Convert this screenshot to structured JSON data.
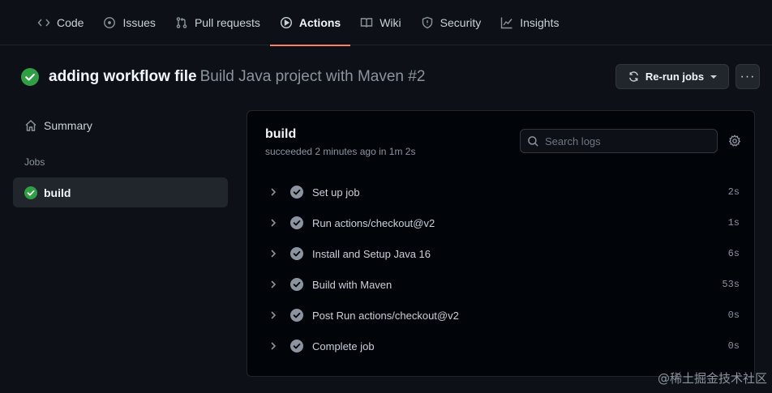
{
  "nav": {
    "tabs": [
      {
        "label": "Code",
        "icon": "code-icon"
      },
      {
        "label": "Issues",
        "icon": "issue-icon"
      },
      {
        "label": "Pull requests",
        "icon": "pull-request-icon"
      },
      {
        "label": "Actions",
        "icon": "play-icon",
        "active": true
      },
      {
        "label": "Wiki",
        "icon": "book-icon"
      },
      {
        "label": "Security",
        "icon": "shield-icon"
      },
      {
        "label": "Insights",
        "icon": "graph-icon"
      }
    ]
  },
  "header": {
    "commit_title": "adding workflow file",
    "workflow_name": "Build Java project with Maven #2",
    "rerun_label": "Re-run jobs",
    "more_label": "···"
  },
  "sidebar": {
    "summary_label": "Summary",
    "jobs_heading": "Jobs",
    "jobs": [
      {
        "label": "build",
        "status": "success"
      }
    ]
  },
  "job": {
    "name": "build",
    "status_text": "succeeded 2 minutes ago in 1m 2s",
    "search_placeholder": "Search logs",
    "steps": [
      {
        "name": "Set up job",
        "duration": "2s"
      },
      {
        "name": "Run actions/checkout@v2",
        "duration": "1s"
      },
      {
        "name": "Install and Setup Java 16",
        "duration": "6s"
      },
      {
        "name": "Build with Maven",
        "duration": "53s"
      },
      {
        "name": "Post Run actions/checkout@v2",
        "duration": "0s"
      },
      {
        "name": "Complete job",
        "duration": "0s"
      }
    ]
  },
  "watermark": "@稀土掘金技术社区",
  "colors": {
    "success": "#2ea043",
    "step_check": "#8b949e",
    "accent_underline": "#f78166",
    "background": "#0d1117"
  }
}
